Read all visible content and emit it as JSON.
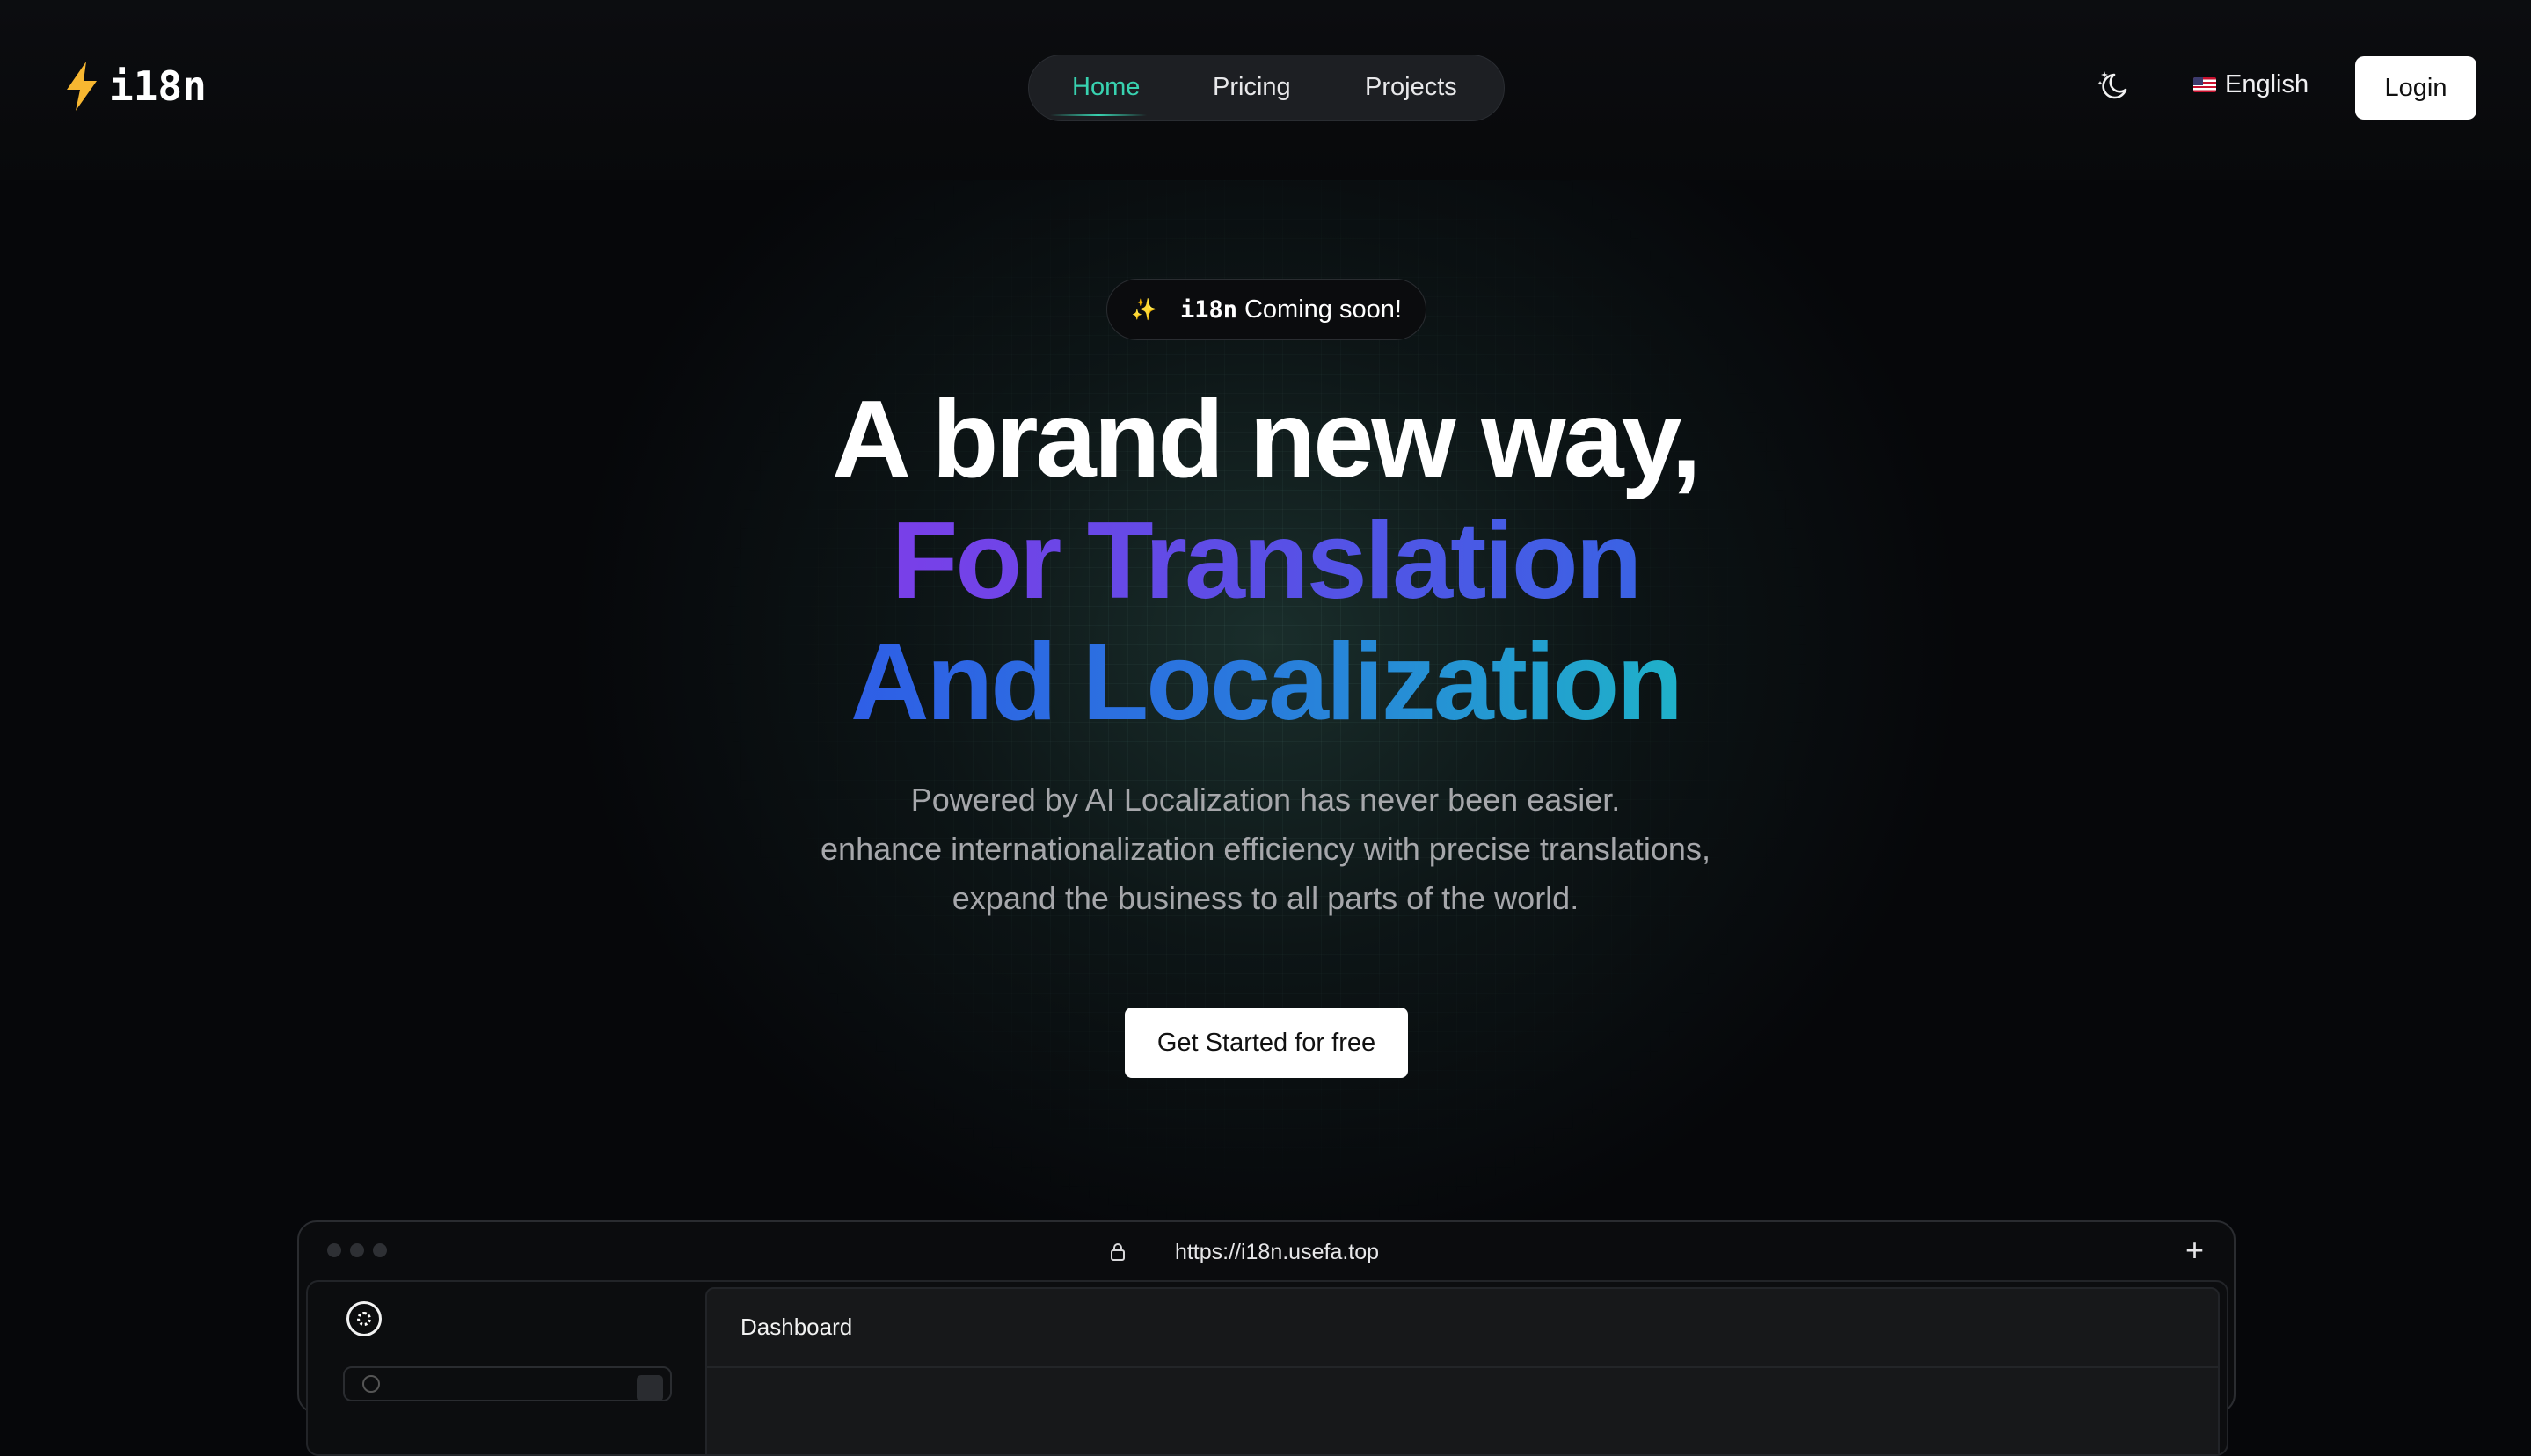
{
  "header": {
    "logo_text": "i18n",
    "logo_icon": "lightning-bolt-icon",
    "nav": [
      {
        "label": "Home",
        "active": true
      },
      {
        "label": "Pricing",
        "active": false
      },
      {
        "label": "Projects",
        "active": false
      }
    ],
    "theme_icon": "moon-sparkle-icon",
    "language": {
      "flag": "us-flag-icon",
      "label": "English"
    },
    "login_label": "Login"
  },
  "hero": {
    "badge": {
      "icon": "sparkles-icon",
      "brand": "i18n",
      "text": "Coming soon!"
    },
    "headline_line1": "A brand new way,",
    "headline_line2": "For Translation",
    "headline_line3": "And Localization",
    "subtitle_lines": [
      "Powered by AI Localization has never been easier.",
      "enhance internationalization efficiency with precise translations,",
      "expand the business to all parts of the world."
    ],
    "cta_label": "Get Started for free"
  },
  "preview": {
    "url": "https://i18n.usefa.top",
    "page_title": "Dashboard"
  },
  "colors": {
    "accent": "#38d2b0",
    "logo_bolt": "#f7b731",
    "gradient_line2": [
      "#7a3fe8",
      "#3a63e4"
    ],
    "gradient_line3": [
      "#2f5ee6",
      "#1fb2c9"
    ]
  }
}
